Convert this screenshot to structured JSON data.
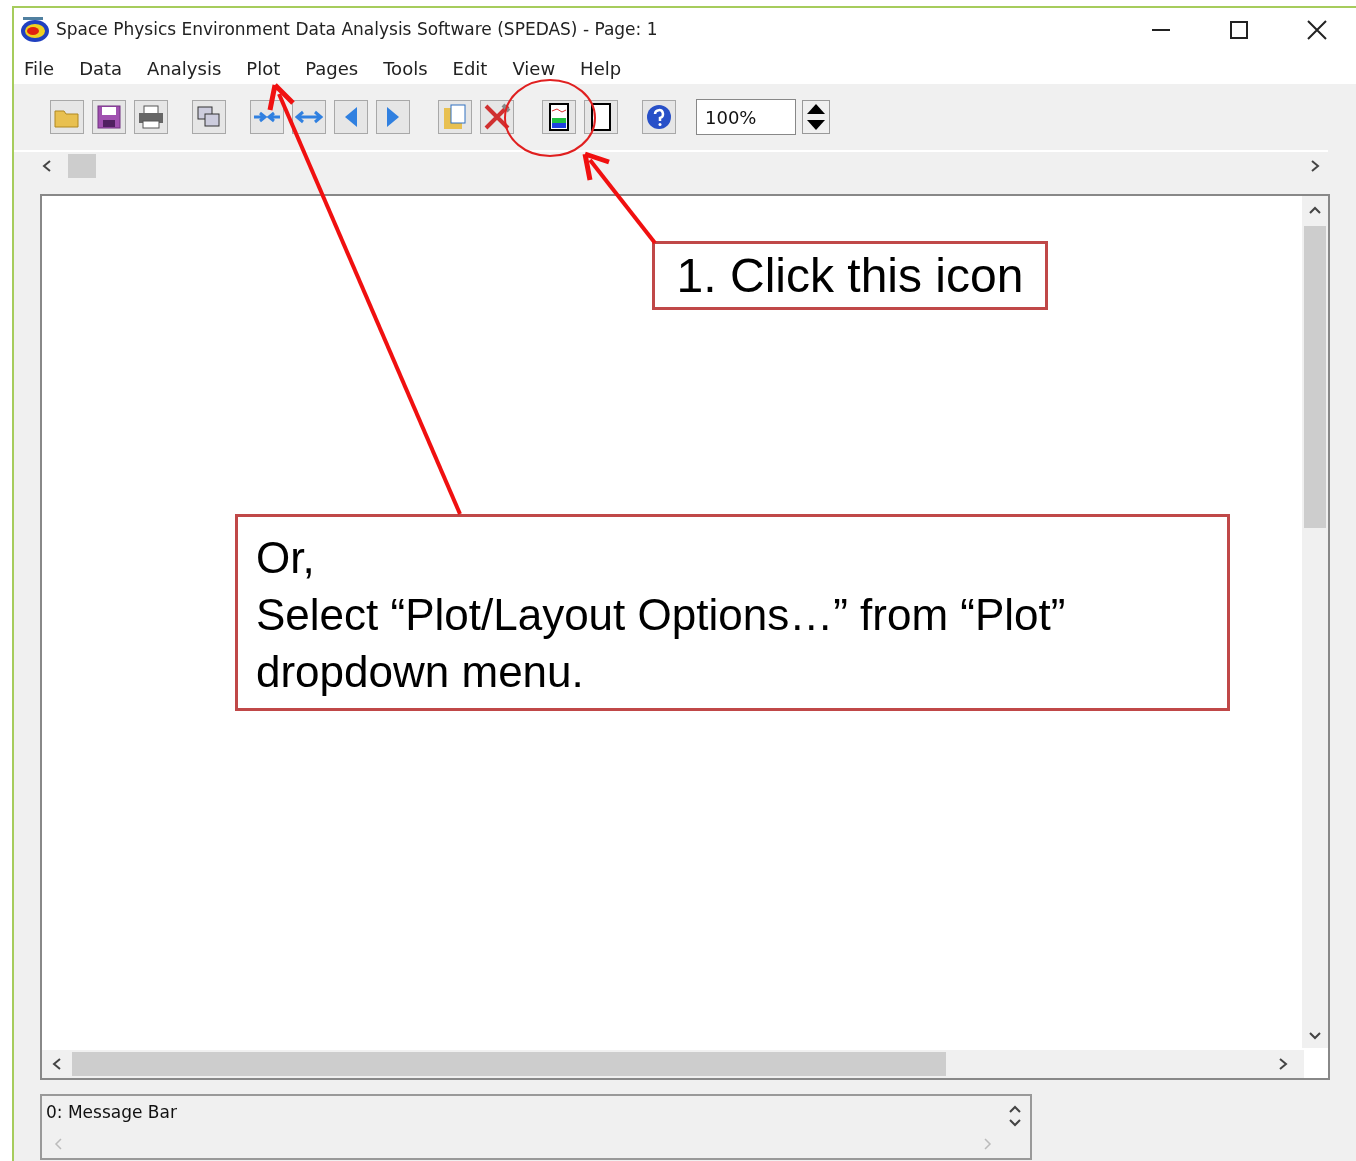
{
  "window": {
    "title": "Space Physics Environment Data Analysis Software (SPEDAS) - Page: 1"
  },
  "menu": [
    "File",
    "Data",
    "Analysis",
    "Plot",
    "Pages",
    "Tools",
    "Edit",
    "View",
    "Help"
  ],
  "zoom_field": {
    "value": "100%"
  },
  "message_bar": {
    "text": "0: Message Bar"
  },
  "annotations": [
    {
      "kind": "callout",
      "text": "1. Click this icon"
    },
    {
      "kind": "note",
      "text": "Or,\nSelect “Plot/Layout Options…” from “Plot”\ndropdown menu."
    }
  ]
}
